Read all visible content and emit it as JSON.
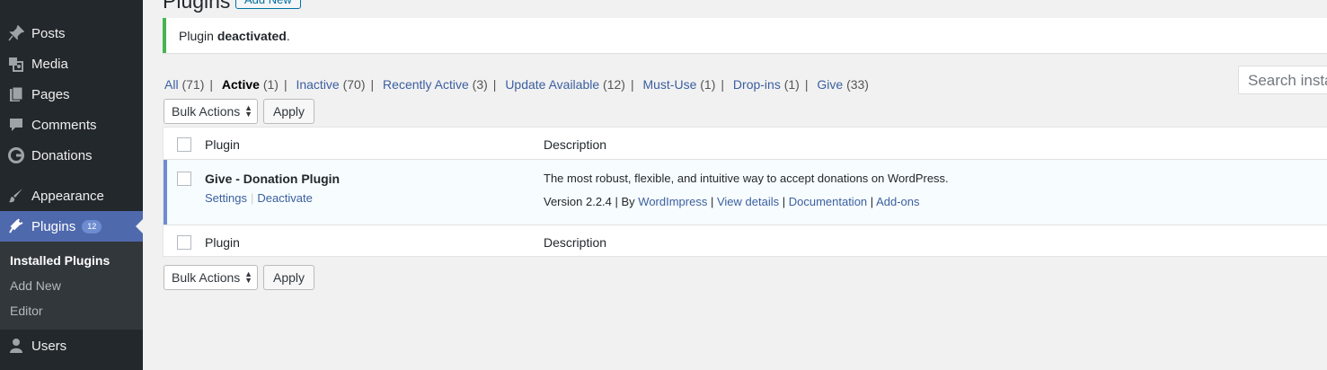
{
  "sidebar": {
    "items": [
      {
        "label": "Posts",
        "icon": "pin-icon"
      },
      {
        "label": "Media",
        "icon": "media-icon"
      },
      {
        "label": "Pages",
        "icon": "pages-icon"
      },
      {
        "label": "Comments",
        "icon": "comment-icon"
      },
      {
        "label": "Donations",
        "icon": "give-icon"
      },
      {
        "label": "Appearance",
        "icon": "brush-icon"
      },
      {
        "label": "Plugins",
        "icon": "plugin-icon",
        "badge": "12"
      },
      {
        "label": "Users",
        "icon": "user-icon"
      }
    ],
    "submenu": [
      "Installed Plugins",
      "Add New",
      "Editor"
    ]
  },
  "header": {
    "title": "Plugins",
    "add_new": "Add New"
  },
  "notice": {
    "prefix": "Plugin",
    "bold": "deactivated",
    "suffix": "."
  },
  "filters": [
    {
      "label": "All",
      "count": "(71)"
    },
    {
      "label": "Active",
      "count": "(1)"
    },
    {
      "label": "Inactive",
      "count": "(70)"
    },
    {
      "label": "Recently Active",
      "count": "(3)"
    },
    {
      "label": "Update Available",
      "count": "(12)"
    },
    {
      "label": "Must-Use",
      "count": "(1)"
    },
    {
      "label": "Drop-ins",
      "count": "(1)"
    },
    {
      "label": "Give",
      "count": "(33)"
    }
  ],
  "search": {
    "placeholder": "Search installed plugins..."
  },
  "bulk": {
    "label": "Bulk Actions",
    "apply": "Apply"
  },
  "table": {
    "col_plugin": "Plugin",
    "col_description": "Description",
    "row": {
      "title": "Give - Donation Plugin",
      "action_settings": "Settings",
      "action_deactivate": "Deactivate",
      "description": "The most robust, flexible, and intuitive way to accept donations on WordPress.",
      "version": "Version 2.2.4",
      "by": "By",
      "author": "WordImpress",
      "view_details": "View details",
      "documentation": "Documentation",
      "addons": "Add-ons"
    }
  },
  "colors": {
    "accent": "#4f69ad",
    "notice_green": "#46b450",
    "link": "#3b5fa0"
  }
}
